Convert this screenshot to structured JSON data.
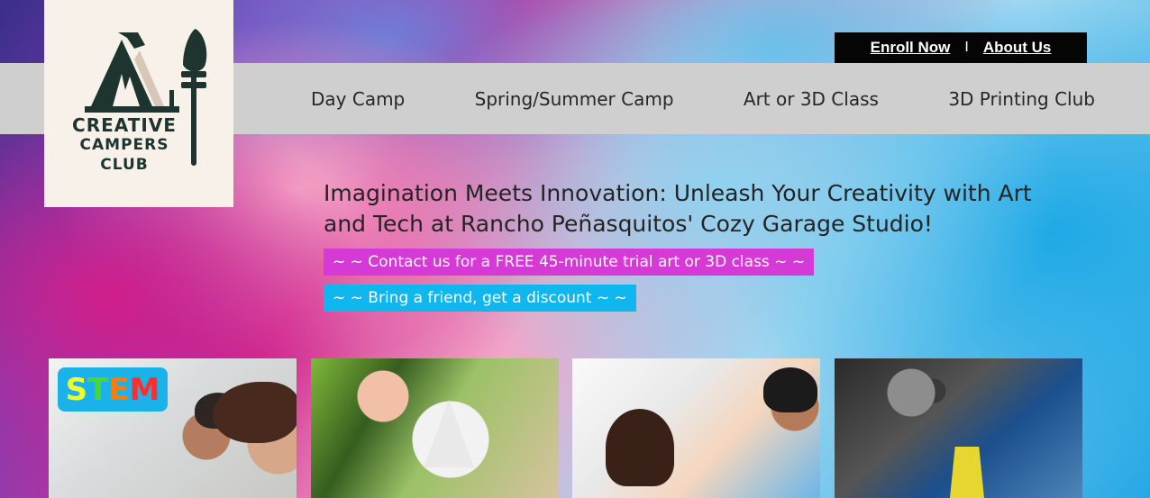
{
  "brand": {
    "line1": "CREATIVE",
    "line2": "CAMPERS",
    "line3": "CLUB"
  },
  "top_links": {
    "enroll": "Enroll Now",
    "separator": "I",
    "about": "About Us"
  },
  "nav": {
    "items": [
      {
        "label": "Day Camp"
      },
      {
        "label": "Spring/Summer Camp"
      },
      {
        "label": "Art or 3D Class"
      },
      {
        "label": "3D Printing Club"
      }
    ]
  },
  "hero": {
    "headline": "Imagination Meets Innovation: Unleash Your Creativity with Art and Tech at Rancho Peñasquitos' Cozy Garage Studio!",
    "promo1": "~ ~ Contact us for a FREE 45-minute trial art or 3D class ~ ~",
    "promo2": "~ ~ Bring a friend, get a discount ~ ~"
  },
  "cards": {
    "badge": {
      "s": "S",
      "t": "T",
      "e": "E",
      "m": "M"
    }
  },
  "colors": {
    "nav_bg": "#cfcfcf",
    "top_links_bg": "#050505",
    "promo_pink": "#d63ad6",
    "promo_blue": "#10b7ef",
    "logo_bg": "#f8f1ea",
    "logo_text": "#1d342f"
  },
  "icons": {
    "logo": "teepee-and-paintbrush-icon"
  }
}
